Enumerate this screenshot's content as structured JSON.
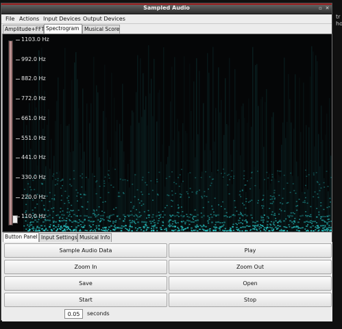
{
  "window": {
    "title": "Sampled Audio"
  },
  "menubar": {
    "items": [
      "File",
      "Actions",
      "Input Devices",
      "Output Devices"
    ]
  },
  "top_tabs": [
    {
      "label": "Amplitude+FFT",
      "active": false
    },
    {
      "label": "Spectrogram",
      "active": true
    },
    {
      "label": "Musical Score",
      "active": false
    }
  ],
  "spectrogram": {
    "frequency_labels": [
      "1103.0 Hz",
      "992.0 Hz",
      "882.0 Hz",
      "772.0 Hz",
      "661.0 Hz",
      "551.0 Hz",
      "441.0 Hz",
      "330.0 Hz",
      "220.0 Hz",
      "110.0 Hz"
    ],
    "colors": {
      "background": "#050607",
      "energy": "#2ee6e6"
    }
  },
  "bottom_tabs": [
    {
      "label": "Button Panel",
      "active": true
    },
    {
      "label": "Input Settings",
      "active": false
    },
    {
      "label": "Musical Info",
      "active": false
    }
  ],
  "buttons": {
    "sample_audio_data": "Sample Audio Data",
    "play": "Play",
    "zoom_in": "Zoom In",
    "zoom_out": "Zoom Out",
    "save": "Save",
    "open": "Open",
    "start": "Start",
    "stop": "Stop"
  },
  "duration": {
    "value": "0.05",
    "unit_label": "seconds"
  },
  "desktop": {
    "fragment_1": "tr",
    "fragment_2": "ho"
  }
}
